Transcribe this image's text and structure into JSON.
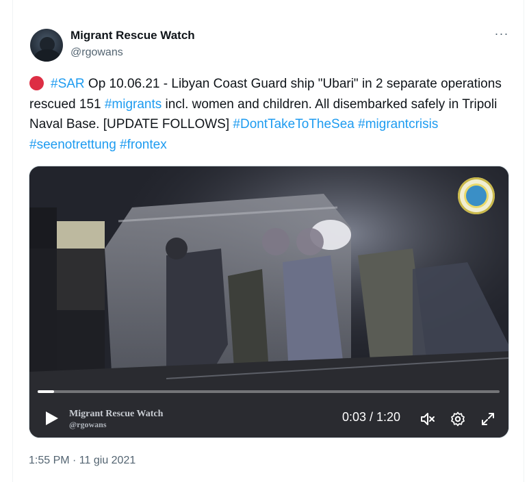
{
  "author": {
    "name": "Migrant Rescue Watch",
    "handle": "@rgowans"
  },
  "more_icon": "more-horizontal-icon",
  "tweet": {
    "segments": [
      {
        "type": "emoji",
        "icon": "red-circle-icon"
      },
      {
        "type": "link",
        "text": "#SAR"
      },
      {
        "type": "text",
        "text": " Op 10.06.21 - Libyan Coast Guard ship \"Ubari\" in 2 separate operations rescued 151 "
      },
      {
        "type": "link",
        "text": "#migrants"
      },
      {
        "type": "text",
        "text": " incl. women and children. All disembarked safely in Tripoli Naval Base. [UPDATE FOLLOWS] "
      },
      {
        "type": "link",
        "text": "#DontTakeToTheSea"
      },
      {
        "type": "text",
        "text": " "
      },
      {
        "type": "link",
        "text": "#migrantcrisis"
      },
      {
        "type": "text",
        "text": " "
      },
      {
        "type": "link",
        "text": "#seenotrettung"
      },
      {
        "type": "text",
        "text": " "
      },
      {
        "type": "link",
        "text": "#frontex"
      }
    ],
    "link_color": "#1d9bf0"
  },
  "video": {
    "watermark_name": "Migrant Rescue Watch",
    "watermark_handle": "@rgowans",
    "time_display": "0:03 / 1:20",
    "progress_fraction": 0.035,
    "icons": [
      "play-icon",
      "volume-muted-icon",
      "settings-icon",
      "fullscreen-icon"
    ]
  },
  "timestamp": "1:55 PM · 11 giu 2021"
}
